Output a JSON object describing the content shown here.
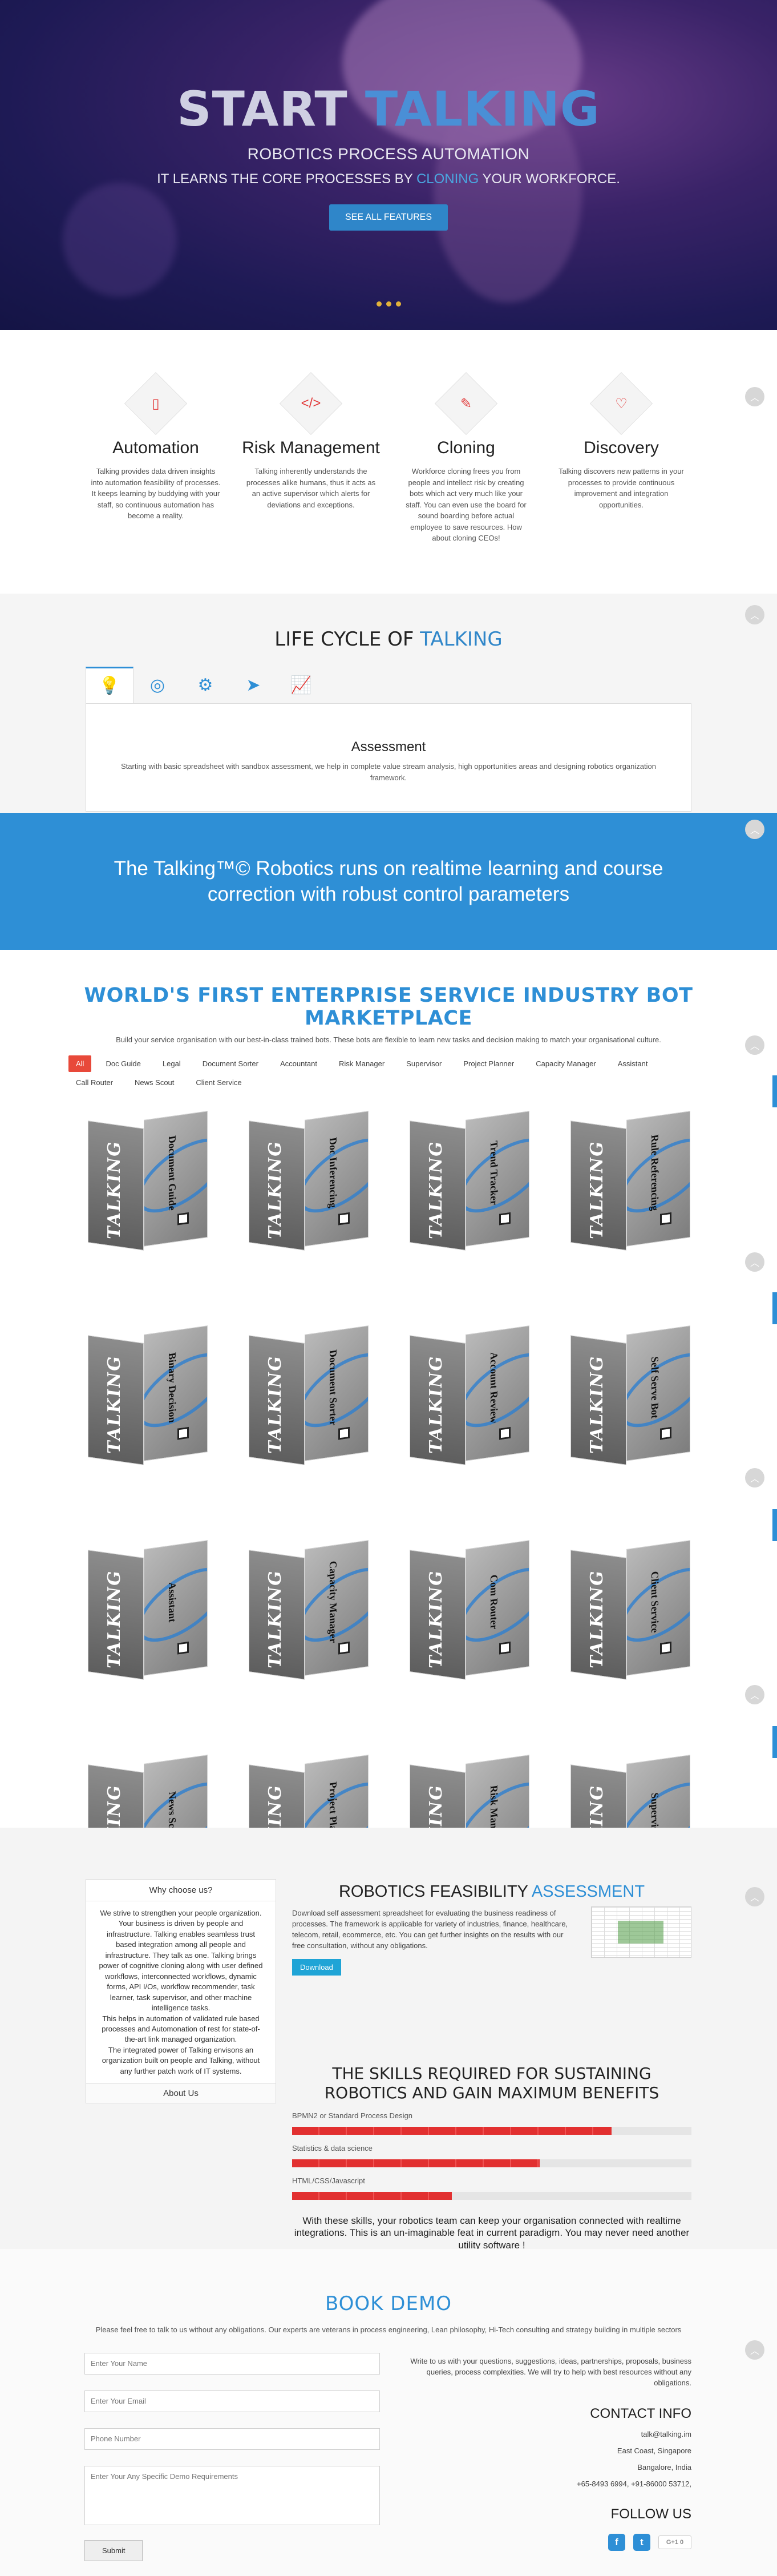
{
  "hero": {
    "title_word1": "START",
    "title_word2": "TALKING",
    "subtitle": "ROBOTICS PROCESS AUTOMATION",
    "tagline_pre": "IT LEARNS THE CORE PROCESSES BY",
    "tagline_highlight": "CLONING",
    "tagline_post": "YOUR WORKFORCE.",
    "button": "SEE ALL FEATURES"
  },
  "features": [
    {
      "icon": "mobile-icon",
      "glyph": "▯",
      "title": "Automation",
      "text": "Talking provides data driven insights into automation feasibility of processes. It keeps learning by buddying with your staff, so continuous automation has become a reality."
    },
    {
      "icon": "code-icon",
      "glyph": "</>",
      "title": "Risk Management",
      "text": "Talking inherently understands the processes alike humans, thus it acts as an active supervisor which alerts for deviations and exceptions."
    },
    {
      "icon": "brush-icon",
      "glyph": "✎",
      "title": "Cloning",
      "text": "Workforce cloning frees you from people and intellect risk by creating bots which act very much like your staff. You can even use the board for sound boarding before actual employee to save resources. How about cloning CEOs!"
    },
    {
      "icon": "heart-icon",
      "glyph": "♡",
      "title": "Discovery",
      "text": "Talking discovers new patterns in your processes to provide continuous improvement and integration opportunities."
    }
  ],
  "lifecycle": {
    "title_pre": "LIFE CYCLE OF",
    "title_highlight": "TALKING",
    "tabs": [
      {
        "icon": "lightbulb-icon",
        "glyph": "💡"
      },
      {
        "icon": "compass-icon",
        "glyph": "◎"
      },
      {
        "icon": "cogs-icon",
        "glyph": "⚙"
      },
      {
        "icon": "paper-plane-icon",
        "glyph": "➤"
      },
      {
        "icon": "line-chart-icon",
        "glyph": "📈"
      }
    ],
    "panel_title": "Assessment",
    "panel_text": "Starting with basic spreadsheet with sandbox assessment, we help in complete value stream analysis, high opportunities areas and designing robotics organization framework."
  },
  "banner": {
    "text": "The Talking™© Robotics runs on realtime learning and course correction with robust control parameters"
  },
  "market": {
    "title": "WORLD'S FIRST ENTERPRISE SERVICE INDUSTRY BOT MARKETPLACE",
    "subtitle": "Build your service organisation with our best-in-class trained bots. These bots are flexible to learn new tasks and decision making to match your organisational culture.",
    "filters": [
      "All",
      "Doc Guide",
      "Legal",
      "Document Sorter",
      "Accountant",
      "Risk Manager",
      "Supervisor",
      "Project Planner",
      "Capacity Manager",
      "Assistant",
      "Call Router",
      "News Scout",
      "Client Service"
    ],
    "brand": "TALKING",
    "products": [
      "Document Guide",
      "Doc Inferencing",
      "Trend Tracker",
      "Rule Referencing",
      "Binary Decision",
      "Document Sorter",
      "Account Review",
      "Self Serve Bot",
      "Assistant",
      "Capacity Manager",
      "Com Router",
      "Client Service",
      "News Scout",
      "Project Planner",
      "Risk Manager",
      "Supervisor"
    ]
  },
  "why": {
    "title": "Why choose us?",
    "body": "We strive to strengthen your people organization. Your business is driven by people and infrastructure. Talking enables seamless trust based integration among all people and infrastructure. They talk as one. Talking brings power of cognitive cloning along with user defined workflows, interconnected workflows, dynamic forms, API I/Os, workflow recommender, task learner, task supervisor, and other machine intelligence tasks.\nThis helps in automation of validated rule based processes and Automonation of rest for state-of-the-art link managed organization.\nThe integrated power of Talking envisons an organization built on people and Talking, without any further patch work of IT systems.",
    "footer": "About Us"
  },
  "rfa": {
    "title_pre": "ROBOTICS FEASIBILITY",
    "title_highlight": "ASSESSMENT",
    "text": "Download self assessment spreadsheet for evaluating the business readiness of processes. The framework is applicable for variety of industries, finance, healthcare, telecom, retail, ecommerce, etc. You can get further insights on the results with our free consultation, without any obligations.",
    "button": "Download"
  },
  "skills": {
    "title": "THE SKILLS REQUIRED FOR SUSTAINING ROBOTICS AND GAIN MAXIMUM BENEFITS",
    "items": [
      {
        "label": "BPMN2 or Standard Process Design",
        "level": 0.8
      },
      {
        "label": "Statistics & data science",
        "level": 0.62
      },
      {
        "label": "HTML/CSS/Javascript",
        "level": 0.4
      }
    ],
    "note": "With these skills, your robotics team can keep your organisation connected with realtime integrations. This is an un-imaginable feat in current paradigm. You may never need another utility software !"
  },
  "demo": {
    "title": "BOOK DEMO",
    "subtitle": "Please feel free to talk to us without any obligations. Our experts are veterans in process engineering, Lean philosophy, Hi-Tech consulting and strategy building in multiple sectors",
    "placeholders": {
      "name": "Enter Your Name",
      "email": "Enter Your Email",
      "phone": "Phone Number",
      "requirements": "Enter Your Any Specific Demo Requirements"
    },
    "submit": "Submit"
  },
  "contact": {
    "intro": "Write to us with your questions, suggestions, ideas, partnerships, proposals, business queries, process complexities. We will try to help with best resources without any obligations.",
    "title": "CONTACT INFO",
    "email": "talk@talking.im",
    "address1": "East Coast, Singapore",
    "address2": "Bangalore, India",
    "phones": "+65-8493 6994, +91-86000 53712,",
    "follow": "FOLLOW US",
    "socials": [
      {
        "icon": "facebook-icon",
        "glyph": "f"
      },
      {
        "icon": "twitter-icon",
        "glyph": "t"
      },
      {
        "icon": "google-plus-icon",
        "glyph": "G+1  0"
      }
    ]
  }
}
